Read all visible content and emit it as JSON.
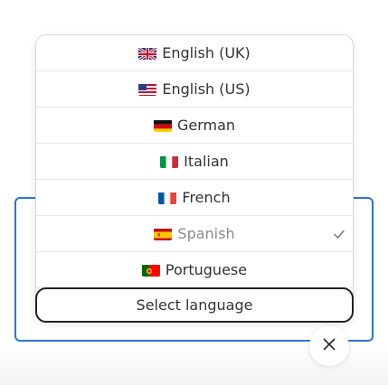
{
  "dropdown": {
    "items": [
      {
        "label": "English (UK)",
        "flag": "uk-flag-icon",
        "selected": false,
        "disabled": false
      },
      {
        "label": "English (US)",
        "flag": "us-flag-icon",
        "selected": false,
        "disabled": false
      },
      {
        "label": "German",
        "flag": "germany-flag-icon",
        "selected": false,
        "disabled": false
      },
      {
        "label": "Italian",
        "flag": "italy-flag-icon",
        "selected": false,
        "disabled": false
      },
      {
        "label": "French",
        "flag": "france-flag-icon",
        "selected": false,
        "disabled": false
      },
      {
        "label": "Spanish",
        "flag": "spain-flag-icon",
        "selected": true,
        "disabled": true
      },
      {
        "label": "Portuguese",
        "flag": "portugal-flag-icon",
        "selected": false,
        "disabled": false
      }
    ]
  },
  "select": {
    "placeholder": "Select language"
  },
  "icons": {
    "check": "check-icon",
    "close": "close-icon"
  },
  "colors": {
    "accent_border": "#2a75d8",
    "trigger_border": "#222222",
    "disabled_text": "#8a8a8a"
  }
}
